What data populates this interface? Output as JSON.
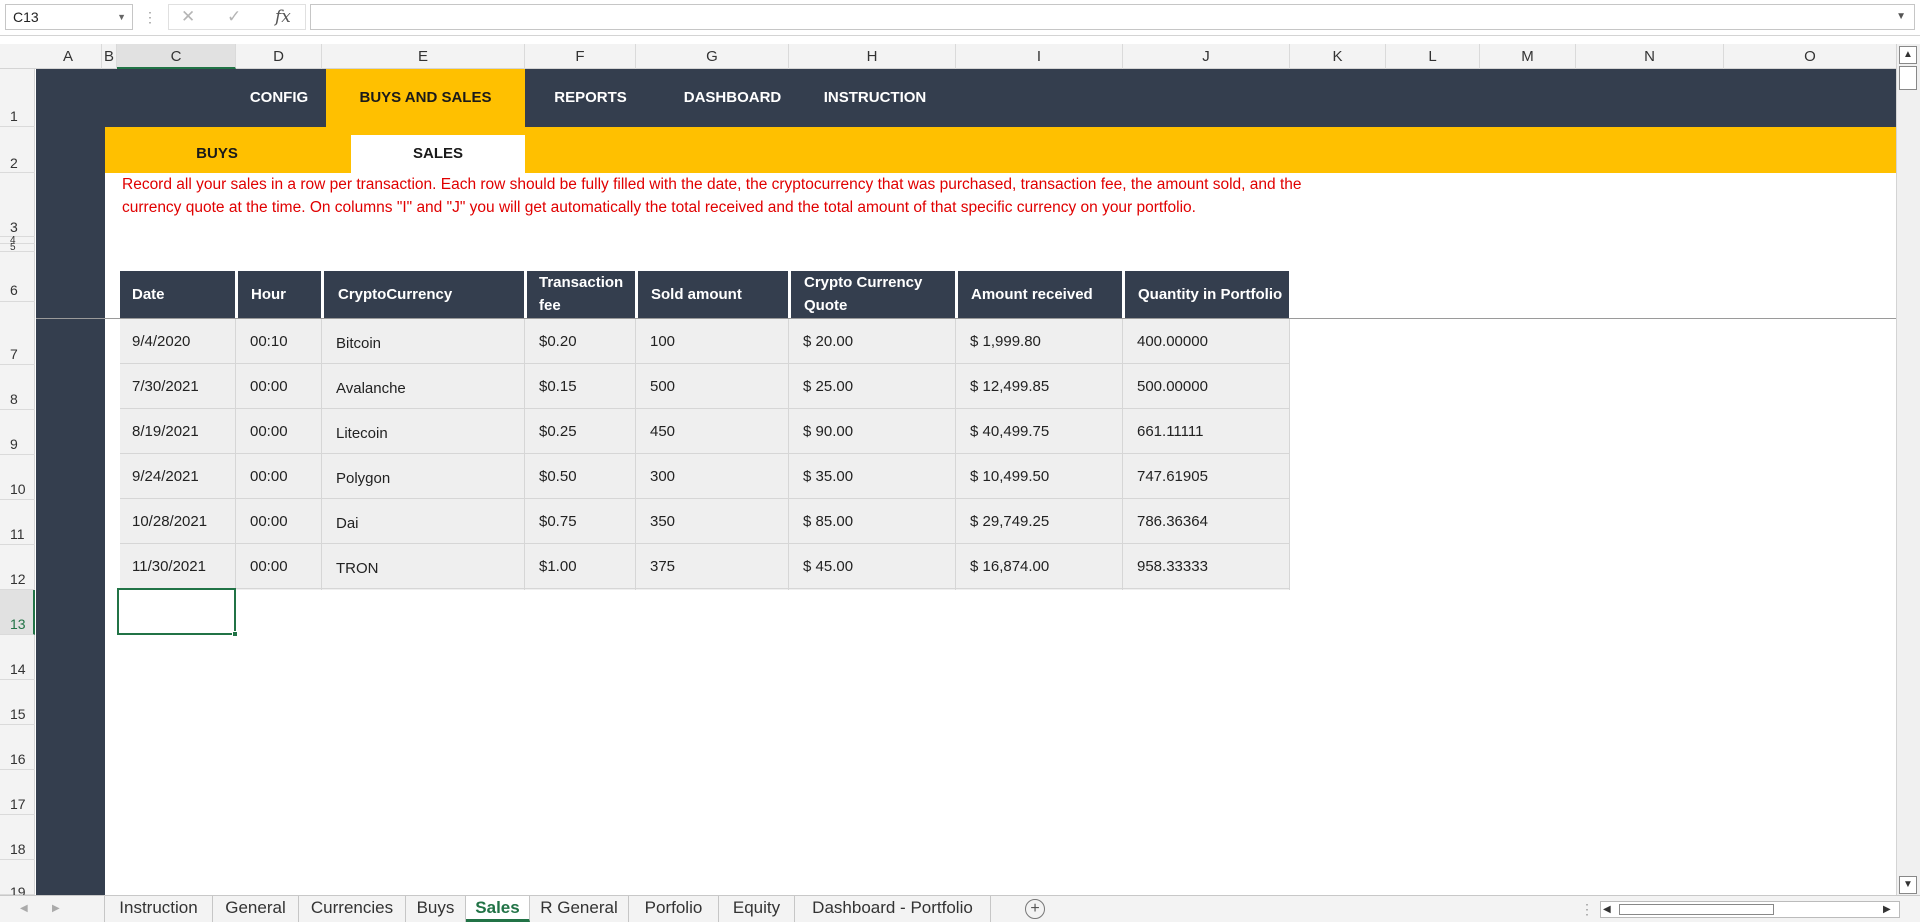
{
  "formula_bar": {
    "name_box": "C13",
    "fx": "fx",
    "formula": ""
  },
  "columns": [
    "A",
    "B",
    "C",
    "D",
    "E",
    "F",
    "G",
    "H",
    "I",
    "J",
    "K",
    "L",
    "M",
    "N",
    "O"
  ],
  "rows": [
    "1",
    "2",
    "3",
    "4",
    "5",
    "6",
    "7",
    "8",
    "9",
    "10",
    "11",
    "12",
    "13",
    "14",
    "15",
    "16",
    "17",
    "18",
    "19"
  ],
  "nav": {
    "items": [
      "CONFIG",
      "BUYS AND SALES",
      "REPORTS",
      "DASHBOARD",
      "INSTRUCTION"
    ],
    "active": "BUYS AND SALES"
  },
  "subnav": {
    "items": [
      "BUYS",
      "SALES"
    ],
    "active": "SALES"
  },
  "instruction": "Record all your sales in a row per transaction. Each row should be fully filled with the date, the cryptocurrency that was purchased, transaction fee, the amount sold, and the currency quote at the time. On columns \"I\" and \"J\" you will get automatically the total received and the total amount of that specific currency on your portfolio.",
  "table": {
    "headers": [
      "Date",
      "Hour",
      "CryptoCurrency",
      "Transaction fee",
      "Sold amount",
      "Crypto Currency Quote",
      "Amount received",
      "Quantity in Portfolio"
    ],
    "rows": [
      [
        "9/4/2020",
        "00:10",
        "Bitcoin",
        "$0.20",
        "100",
        "$ 20.00",
        "$ 1,999.80",
        "400.00000"
      ],
      [
        "7/30/2021",
        "00:00",
        "Avalanche",
        "$0.15",
        "500",
        "$ 25.00",
        "$ 12,499.85",
        "500.00000"
      ],
      [
        "8/19/2021",
        "00:00",
        "Litecoin",
        "$0.25",
        "450",
        "$ 90.00",
        "$ 40,499.75",
        "661.11111"
      ],
      [
        "9/24/2021",
        "00:00",
        "Polygon",
        "$0.50",
        "300",
        "$ 35.00",
        "$ 10,499.50",
        "747.61905"
      ],
      [
        "10/28/2021",
        "00:00",
        "Dai",
        "$0.75",
        "350",
        "$ 85.00",
        "$ 29,749.25",
        "786.36364"
      ],
      [
        "11/30/2021",
        "00:00",
        "TRON",
        "$1.00",
        "375",
        "$ 45.00",
        "$ 16,874.00",
        "958.33333"
      ]
    ]
  },
  "sheet_tabs": {
    "items": [
      "Instruction",
      "General",
      "Currencies",
      "Buys",
      "Sales",
      "R General",
      "Porfolio",
      "Equity",
      "Dashboard - Portfolio"
    ],
    "active": "Sales"
  },
  "colors": {
    "navy": "#343e4e",
    "gold": "#ffc000",
    "red_text": "#e00000",
    "row_bg": "#efefef",
    "active_green": "#217346"
  }
}
